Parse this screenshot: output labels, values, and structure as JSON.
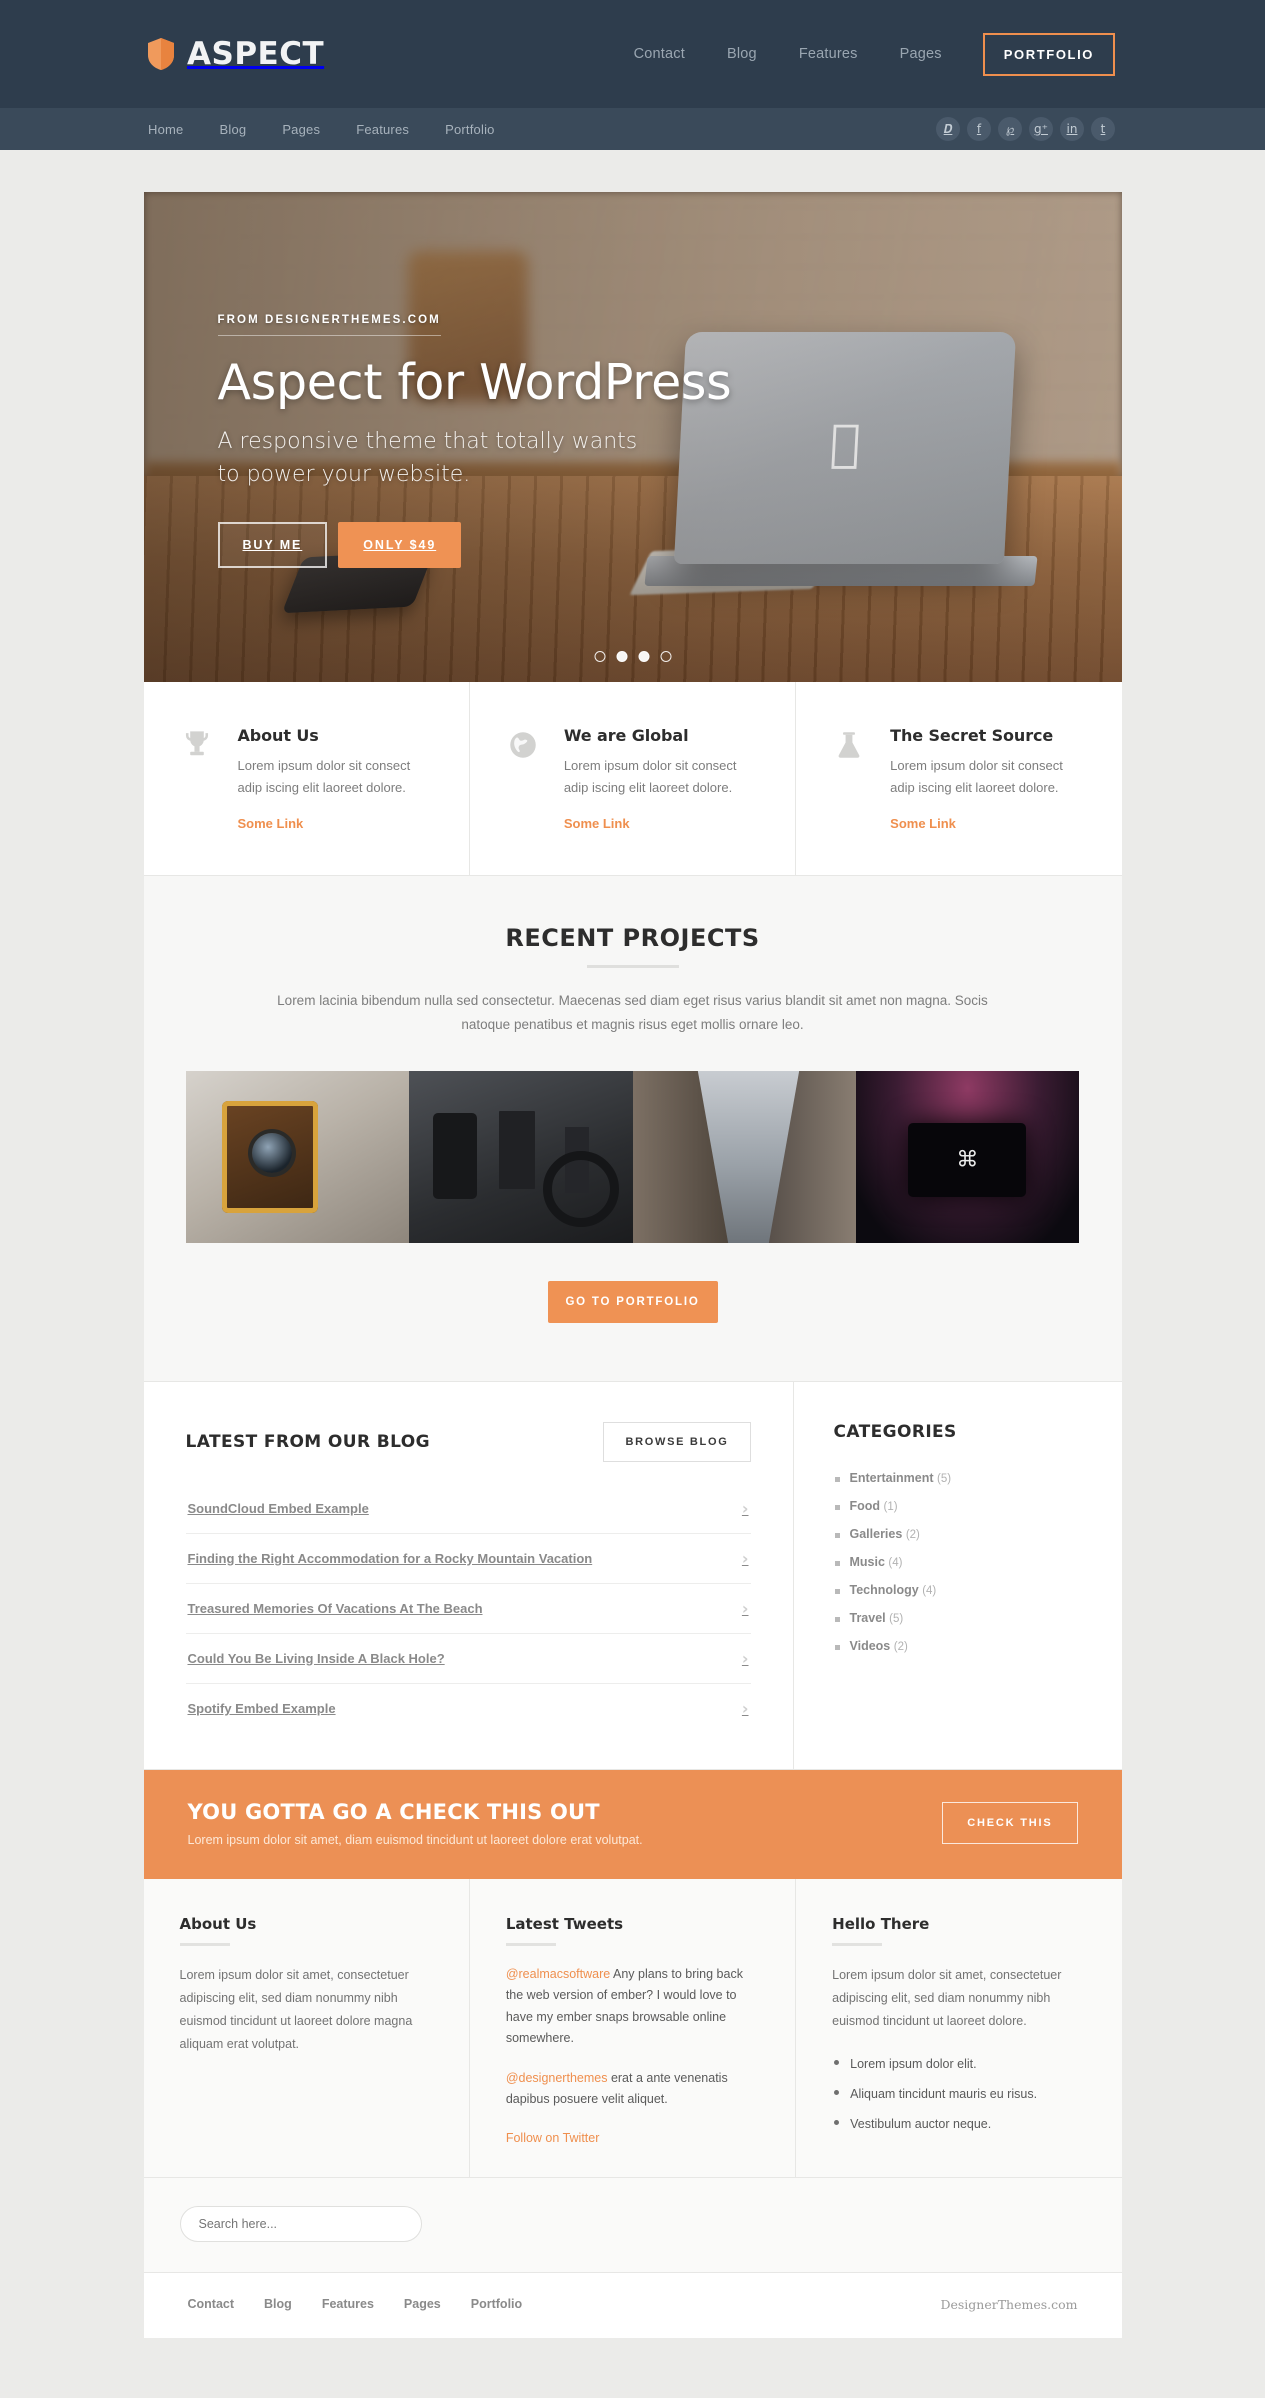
{
  "header": {
    "brand": "ASPECT",
    "logo_icon": "shield-icon",
    "nav": [
      {
        "label": "Contact"
      },
      {
        "label": "Blog"
      },
      {
        "label": "Features"
      },
      {
        "label": "Pages"
      }
    ],
    "cta": "PORTFOLIO"
  },
  "subnav": {
    "links": [
      {
        "label": "Home"
      },
      {
        "label": "Blog"
      },
      {
        "label": "Pages"
      },
      {
        "label": "Features"
      },
      {
        "label": "Portfolio"
      }
    ],
    "socials": [
      {
        "name": "twitter-icon",
        "glyph": "𝑫"
      },
      {
        "name": "facebook-icon",
        "glyph": "f"
      },
      {
        "name": "pinterest-icon",
        "glyph": "℘"
      },
      {
        "name": "googleplus-icon",
        "glyph": "g⁺"
      },
      {
        "name": "linkedin-icon",
        "glyph": "in"
      },
      {
        "name": "tumblr-icon",
        "glyph": "t"
      }
    ]
  },
  "hero": {
    "kicker": "FROM DESIGNERTHEMES.COM",
    "title": "Aspect for WordPress",
    "subtitle_line1": "A responsive theme that totally wants",
    "subtitle_line2": "to power your website.",
    "btn_primary": "BUY ME",
    "btn_secondary": "ONLY $49",
    "slides": 4,
    "active_slide": 1
  },
  "features": [
    {
      "icon": "trophy-icon",
      "title": "About Us",
      "text": "Lorem ipsum dolor sit consect adip iscing elit laoreet dolore.",
      "link": "Some Link"
    },
    {
      "icon": "globe-icon",
      "title": "We are Global",
      "text": "Lorem ipsum dolor sit consect adip iscing elit laoreet dolore.",
      "link": "Some Link"
    },
    {
      "icon": "flask-icon",
      "title": "The Secret Source",
      "text": "Lorem ipsum dolor sit consect adip iscing elit laoreet dolore.",
      "link": "Some Link"
    }
  ],
  "projects": {
    "title": "RECENT PROJECTS",
    "description": "Lorem lacinia bibendum nulla sed consectetur. Maecenas sed diam eget risus varius blandit sit amet non magna. Socis natoque penatibus et magnis risus eget mollis ornare leo.",
    "thumbs": [
      {
        "name": "thumb-camera"
      },
      {
        "name": "thumb-desk-flatlay"
      },
      {
        "name": "thumb-alley"
      },
      {
        "name": "thumb-laptop-dark"
      }
    ],
    "button": "GO TO PORTFOLIO"
  },
  "blog": {
    "title": "LATEST FROM OUR BLOG",
    "browse_label": "BROWSE BLOG",
    "items": [
      {
        "title": "SoundCloud Embed Example"
      },
      {
        "title": "Finding the Right Accommodation for a Rocky Mountain Vacation"
      },
      {
        "title": "Treasured Memories Of Vacations At The Beach"
      },
      {
        "title": "Could You Be Living Inside A Black Hole?"
      },
      {
        "title": "Spotify Embed Example"
      }
    ]
  },
  "categories": {
    "title": "CATEGORIES",
    "items": [
      {
        "label": "Entertainment",
        "count": "(5)"
      },
      {
        "label": "Food",
        "count": "(1)"
      },
      {
        "label": "Galleries",
        "count": "(2)"
      },
      {
        "label": "Music",
        "count": "(4)"
      },
      {
        "label": "Technology",
        "count": "(4)"
      },
      {
        "label": "Travel",
        "count": "(5)"
      },
      {
        "label": "Videos",
        "count": "(2)"
      }
    ]
  },
  "cta_banner": {
    "title": "YOU GOTTA GO A CHECK THIS OUT",
    "subtitle": "Lorem ipsum dolor sit amet, diam euismod tincidunt ut laoreet dolore erat volutpat.",
    "button": "CHECK THIS",
    "color": "#ec9055"
  },
  "footer": {
    "about": {
      "title": "About Us",
      "text": "Lorem ipsum dolor sit amet, consectetuer adipiscing elit, sed diam nonummy nibh euismod tincidunt ut laoreet dolore magna aliquam erat volutpat."
    },
    "tweets": {
      "title": "Latest Tweets",
      "items": [
        {
          "handle": "@realmacsoftware",
          "text": " Any plans to bring back the web version of ember? I would love to have my ember snaps browsable online somewhere."
        },
        {
          "handle": "@designerthemes",
          "text": " erat a ante venenatis dapibus posuere velit aliquet."
        }
      ],
      "follow": "Follow on Twitter"
    },
    "hello": {
      "title": "Hello There",
      "text": "Lorem ipsum dolor sit amet, consectetuer adipiscing elit, sed diam nonummy nibh euismod tincidunt ut laoreet dolore.",
      "bullets": [
        "Lorem ipsum dolor elit.",
        "Aliquam tincidunt mauris eu risus.",
        "Vestibulum auctor neque."
      ]
    },
    "search_placeholder": "Search here...",
    "bottom_links": [
      {
        "label": "Contact"
      },
      {
        "label": "Blog"
      },
      {
        "label": "Features"
      },
      {
        "label": "Pages"
      },
      {
        "label": "Portfolio"
      }
    ],
    "credit": "DesignerThemes.com"
  }
}
